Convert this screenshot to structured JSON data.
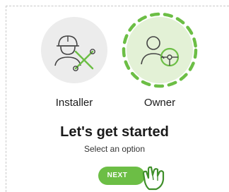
{
  "options": [
    {
      "label": "Installer",
      "icon": "installer-icon",
      "selected": false
    },
    {
      "label": "Owner",
      "icon": "owner-icon",
      "selected": true
    }
  ],
  "heading": {
    "title": "Let's get started",
    "subtitle": "Select an option"
  },
  "actions": {
    "next_label": "NEXT"
  },
  "colors": {
    "accent": "#6cbe45",
    "selected_bg": "#e3f1d6",
    "unselected_bg": "#ececec",
    "text": "#1a1a1a"
  }
}
